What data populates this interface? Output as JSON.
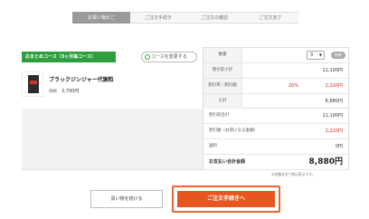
{
  "steps": [
    "お買い物かご",
    "ご注文手続き",
    "ご注文の確認",
    "ご注文完了"
  ],
  "course": {
    "badge": "おまとめコース（3ヶ月毎コース）",
    "change_button": "コースを変更する"
  },
  "product": {
    "name": "ブラックジンジャー代謝粒",
    "price_label": "価格",
    "price": "3,700円"
  },
  "order_rows": [
    {
      "label": "数量",
      "qty": "3",
      "delete": "削除"
    },
    {
      "label": "割引前小計",
      "value": "11,100円"
    },
    {
      "label": "割引率／割引額",
      "pct": "20%",
      "value": "2,220円"
    },
    {
      "label": "小計",
      "value": "8,880円"
    }
  ],
  "totals": [
    {
      "label": "割引前合計",
      "value": "11,100円"
    },
    {
      "label": "割引額（お得になる金額）",
      "value": "2,220円"
    },
    {
      "label": "送料",
      "value": "0円"
    },
    {
      "label": "お支払い合計金額",
      "value": "8,880円"
    }
  ],
  "note": "※金額は全て税込表示です。",
  "buttons": {
    "continue": "買い物を続ける",
    "checkout": "ご注文手続きへ"
  },
  "colors": {
    "accent": "#e8561f",
    "course_green": "#2f9e3f",
    "discount_red": "#d6261e"
  }
}
